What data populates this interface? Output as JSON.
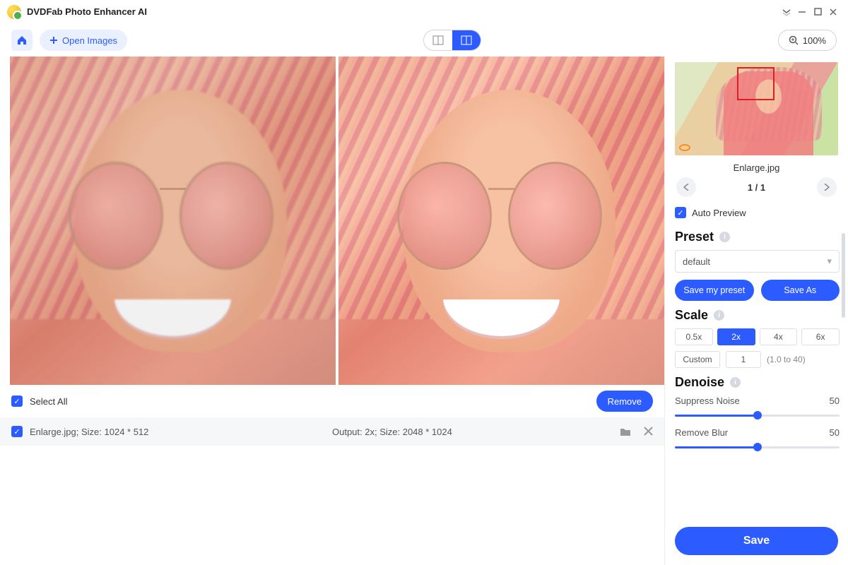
{
  "titlebar": {
    "title": "DVDFab Photo Enhancer AI"
  },
  "toolbar": {
    "open_label": "Open Images",
    "zoom_label": "100%"
  },
  "list": {
    "select_all_label": "Select All",
    "remove_label": "Remove",
    "file_info": "Enlarge.jpg; Size: 1024 * 512",
    "output_info": "Output: 2x; Size: 2048 * 1024"
  },
  "sidebar": {
    "filename": "Enlarge.jpg",
    "counter": "1 / 1",
    "auto_preview_label": "Auto Preview",
    "preset": {
      "title": "Preset",
      "selected": "default",
      "save_my_label": "Save my preset",
      "save_as_label": "Save As"
    },
    "scale": {
      "title": "Scale",
      "options": [
        "0.5x",
        "2x",
        "4x",
        "6x"
      ],
      "active": "2x",
      "custom_label": "Custom",
      "custom_value": "1",
      "range_hint": "(1.0 to 40)"
    },
    "denoise": {
      "title": "Denoise",
      "suppress_label": "Suppress Noise",
      "suppress_value": "50",
      "blur_label": "Remove Blur",
      "blur_value": "50"
    },
    "save_label": "Save"
  }
}
